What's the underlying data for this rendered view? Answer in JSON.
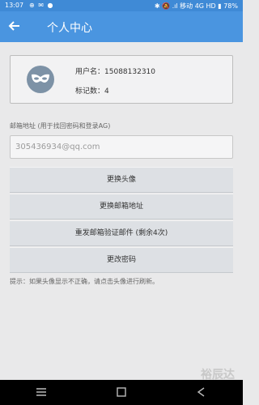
{
  "status_bar": {
    "time": "13:07",
    "left_icons": "⊕ ✉ ●",
    "right": "✱ 🔕 .ıl 移动 4G HD ▮ 78%"
  },
  "app_bar": {
    "title": "个人中心"
  },
  "profile": {
    "username_label": "用户名：",
    "username": "15088132310",
    "marks_label": "标记数：",
    "marks_count": "4"
  },
  "email": {
    "label": "邮箱地址 (用于找回密码和登录AG)",
    "value": "305436934@qq.com"
  },
  "actions": [
    {
      "label": "更换头像"
    },
    {
      "label": "更换邮箱地址"
    },
    {
      "label": "重发邮箱验证邮件 (剩余4次)"
    },
    {
      "label": "更改密码"
    }
  ],
  "tip": "提示：如果头像显示不正确，请点击头像进行刷新。",
  "watermark": "裕辰达",
  "colors": {
    "primary": "#4a95e0",
    "status_bar": "#3f8ad6",
    "background": "#e9e9ea"
  }
}
